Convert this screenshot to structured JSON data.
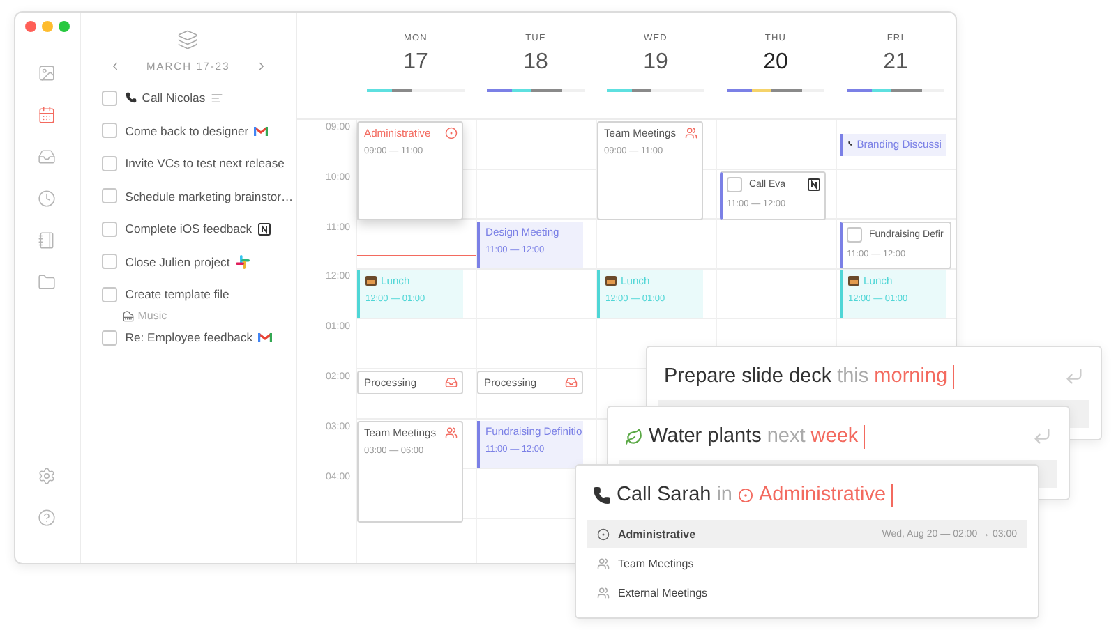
{
  "nav": {
    "items": [
      {
        "selected": false
      },
      {
        "selected": true
      },
      {
        "selected": false
      },
      {
        "selected": false
      },
      {
        "selected": false
      },
      {
        "selected": false
      }
    ]
  },
  "tasks": {
    "range": "MARCH 17-23",
    "items": [
      {
        "label": "Call Nicolas",
        "checked": false
      },
      {
        "label": "Come back to designer",
        "checked": false
      },
      {
        "label": "Invite VCs to test next release",
        "checked": false
      },
      {
        "label": "Schedule marketing brainstor…",
        "checked": false
      },
      {
        "label": "Complete iOS feedback",
        "checked": false
      },
      {
        "label": "Close Julien project",
        "checked": false
      },
      {
        "label": "Create template file",
        "checked": false,
        "sublabel": "Music"
      },
      {
        "label": "Re: Employee feedback",
        "checked": false
      }
    ]
  },
  "calendar": {
    "hours": [
      "09:00",
      "10:00",
      "11:00",
      "12:00",
      "01:00",
      "02:00",
      "03:00",
      "04:00"
    ],
    "days": [
      {
        "name": "MON",
        "date": "17",
        "today": false,
        "load": [
          {
            "color": "#5ee0e0"
          },
          {
            "color": "#8a8a8a"
          }
        ],
        "now_line": true,
        "events": [
          {
            "kind": "block",
            "title": "Administrative",
            "time": "09:00 — 11:00",
            "selected": true
          },
          {
            "kind": "accent",
            "title": "Lunch",
            "time": "12:00 — 01:00",
            "color": "#4fd6d6"
          },
          {
            "kind": "block",
            "title": "Processing",
            "selected": false
          },
          {
            "kind": "block",
            "title": "Team Meetings",
            "time": "03:00 — 06:00",
            "selected": false
          }
        ]
      },
      {
        "name": "TUE",
        "date": "18",
        "today": false,
        "load": [
          {
            "color": "#7b80e6"
          },
          {
            "color": "#5ee0e0"
          },
          {
            "color": "#8a8a8a"
          }
        ],
        "events": [
          {
            "kind": "accent",
            "title": "Design Meeting",
            "time": "11:00 — 12:00",
            "color": "#7b80e6"
          },
          {
            "kind": "block",
            "title": "Processing",
            "selected": false
          },
          {
            "kind": "accent",
            "title": "Fundraising Definitio",
            "time": "11:00 — 12:00",
            "color": "#7b80e6"
          }
        ]
      },
      {
        "name": "WED",
        "date": "19",
        "today": false,
        "load": [
          {
            "color": "#5ee0e0"
          },
          {
            "color": "#8a8a8a"
          }
        ],
        "events": [
          {
            "kind": "block",
            "title": "Team Meetings",
            "time": "09:00 — 11:00",
            "selected": false
          },
          {
            "kind": "accent",
            "title": "Lunch",
            "time": "12:00 — 01:00",
            "color": "#4fd6d6"
          }
        ]
      },
      {
        "name": "THU",
        "date": "20",
        "today": true,
        "load": [
          {
            "color": "#7b80e6"
          },
          {
            "color": "#f5d36a"
          },
          {
            "color": "#8a8a8a"
          }
        ],
        "events": [
          {
            "kind": "task",
            "title": "Call Eva",
            "time": "11:00 — 12:00",
            "checked": false
          }
        ]
      },
      {
        "name": "FRI",
        "date": "21",
        "today": false,
        "load": [
          {
            "color": "#7b80e6"
          },
          {
            "color": "#5ee0e0"
          },
          {
            "color": "#8a8a8a"
          }
        ],
        "events": [
          {
            "kind": "accent",
            "title": "Branding Discussi",
            "color": "#7b80e6"
          },
          {
            "kind": "task",
            "title": "Fundraising Defir",
            "time": "11:00 — 12:00",
            "checked": false
          },
          {
            "kind": "accent",
            "title": "Lunch",
            "time": "12:00 — 01:00",
            "color": "#4fd6d6"
          }
        ]
      }
    ]
  },
  "quick_add": [
    {
      "parts": [
        {
          "kind": "subject",
          "text": "Prepare slide deck"
        },
        {
          "kind": "keyword",
          "text": "this"
        },
        {
          "kind": "value",
          "text": "morning"
        }
      ]
    },
    {
      "parts": [
        {
          "kind": "subject",
          "text": "Water plants"
        },
        {
          "kind": "keyword",
          "text": "next"
        },
        {
          "kind": "value",
          "text": "week"
        }
      ]
    },
    {
      "parts": [
        {
          "kind": "subject",
          "text": "Call Sarah"
        },
        {
          "kind": "keyword",
          "text": "in"
        },
        {
          "kind": "value",
          "text": "Administrative"
        }
      ],
      "suggestions": [
        {
          "label": "Administrative",
          "detail": "Wed, Aug 20 — 02:00 → 03:00",
          "selected": true
        },
        {
          "label": "Team Meetings",
          "selected": false
        },
        {
          "label": "External Meetings",
          "selected": false
        }
      ]
    }
  ]
}
